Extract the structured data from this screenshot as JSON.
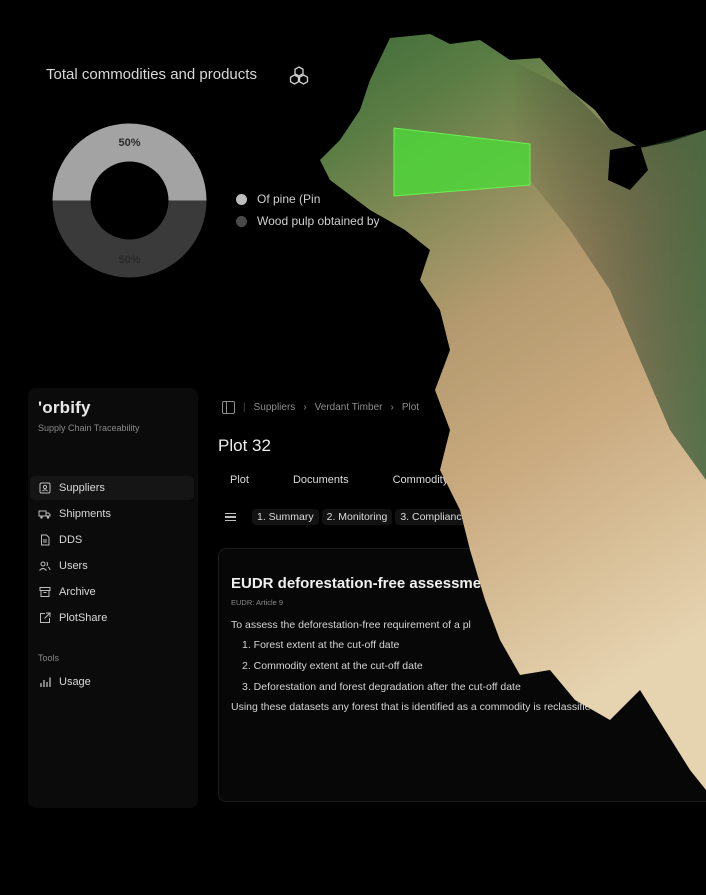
{
  "commodities": {
    "title": "Total commodities and products",
    "icon": "cubes-icon",
    "donut": {
      "slices": [
        {
          "label": "50%",
          "value": 50,
          "color": "#a3a3a3"
        },
        {
          "label": "50%",
          "value": 50,
          "color": "#3a3a3a"
        }
      ]
    },
    "legend": [
      {
        "label": "Of pine (Pin",
        "color": "#bdbdbd"
      },
      {
        "label": "Wood pulp obtained by",
        "color": "#4a4a4a"
      }
    ]
  },
  "sidebar": {
    "logo": "'orbify",
    "subtitle": "Supply Chain Traceability",
    "items": [
      {
        "label": "Suppliers",
        "icon": "id-card-icon",
        "active": true
      },
      {
        "label": "Shipments",
        "icon": "truck-icon",
        "active": false
      },
      {
        "label": "DDS",
        "icon": "document-icon",
        "active": false
      },
      {
        "label": "Users",
        "icon": "users-icon",
        "active": false
      },
      {
        "label": "Archive",
        "icon": "archive-icon",
        "active": false
      },
      {
        "label": "PlotShare",
        "icon": "share-icon",
        "active": false
      }
    ],
    "tools_label": "Tools",
    "tools_items": [
      {
        "label": "Usage",
        "icon": "bar-chart-icon"
      }
    ]
  },
  "breadcrumb": [
    "Suppliers",
    "Verdant Timber",
    "Plot"
  ],
  "page_title": "Plot 32",
  "tabs": [
    "Plot",
    "Documents",
    "Commodity"
  ],
  "steps": [
    "1. Summary",
    "2. Monitoring",
    "3. Compliance"
  ],
  "card": {
    "title": "EUDR deforestation-free assessme",
    "subtitle": "EUDR: Article 9",
    "intro": "To assess the deforestation-free requirement of a pl",
    "list": [
      "1. Forest extent at the cut-off date",
      "2. Commodity extent at the cut-off date",
      "3. Deforestation and forest degradation after the cut-off date"
    ],
    "footer": "Using these datasets any forest that is identified as a commodity is reclassifie"
  }
}
